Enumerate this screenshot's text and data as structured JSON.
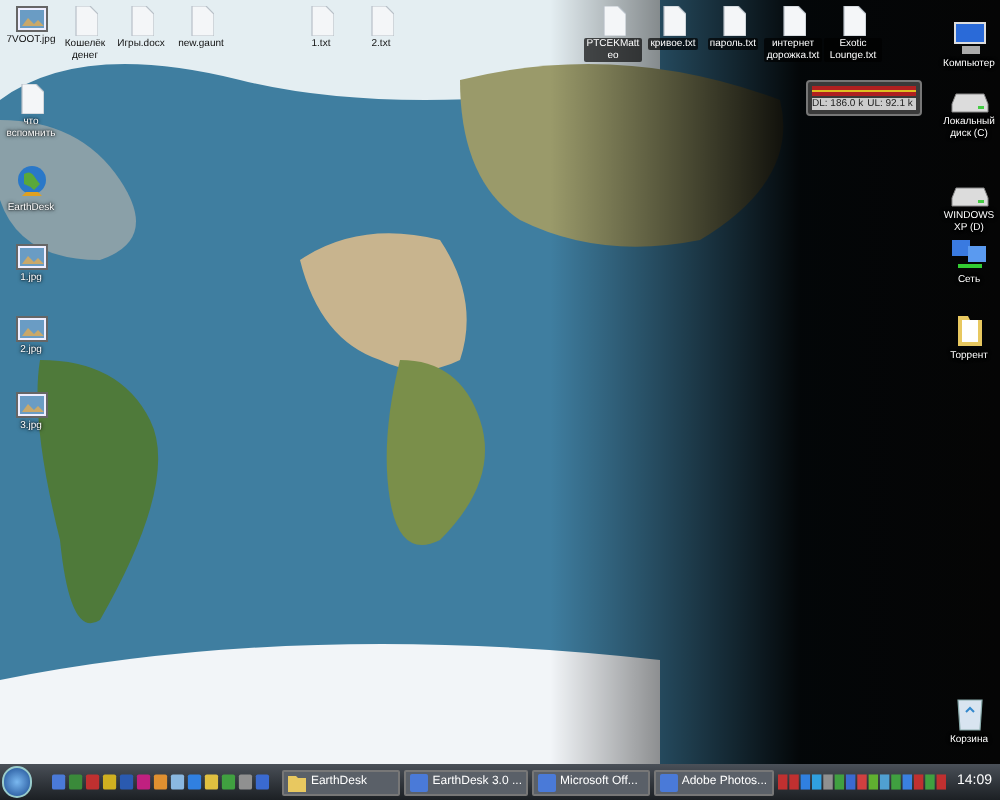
{
  "desktop": {
    "top_icons": [
      {
        "label": "7VOOT.jpg",
        "kind": "image"
      },
      {
        "label": "Кошелёк денег",
        "kind": "document"
      },
      {
        "label": "Игры.docx",
        "kind": "document"
      },
      {
        "label": "new.gaunt",
        "kind": "document"
      },
      {
        "label": "1.txt",
        "kind": "document"
      },
      {
        "label": "2.txt",
        "kind": "document"
      },
      {
        "label": "PTCEKMatteo",
        "kind": "document"
      },
      {
        "label": "кривое.txt",
        "kind": "document"
      },
      {
        "label": "пароль.txt",
        "kind": "document"
      },
      {
        "label": "интернет дорожка.txt",
        "kind": "document"
      },
      {
        "label": "Exotic Lounge.txt",
        "kind": "document"
      }
    ],
    "left_icons": [
      {
        "label": "что вспомнить",
        "kind": "document"
      },
      {
        "label": "EarthDesk",
        "kind": "globe"
      },
      {
        "label": "1.jpg",
        "kind": "image"
      },
      {
        "label": "2.jpg",
        "kind": "image"
      },
      {
        "label": "3.jpg",
        "kind": "image"
      }
    ],
    "right_icons": [
      {
        "label": "Компьютер",
        "kind": "computer"
      },
      {
        "label": "Локальный диск (C)",
        "kind": "drive"
      },
      {
        "label": "WINDOWS XP (D)",
        "kind": "drive"
      },
      {
        "label": "Сеть",
        "kind": "network"
      },
      {
        "label": "Торрент",
        "kind": "folder"
      },
      {
        "label": "Корзина",
        "kind": "recycle"
      }
    ],
    "gadget": {
      "download": "DL: 186.0 k",
      "upload": "UL: 92.1 k"
    }
  },
  "taskbar": {
    "tasks": [
      {
        "label": "EarthDesk",
        "kind": "folder",
        "selected": false
      },
      {
        "label": "EarthDesk 3.0 ...",
        "kind": "app",
        "selected": false
      },
      {
        "label": "Microsoft Off...",
        "kind": "app",
        "selected": false
      },
      {
        "label": "Adobe Photos...",
        "kind": "app",
        "selected": false
      }
    ],
    "clock": "14:09"
  }
}
